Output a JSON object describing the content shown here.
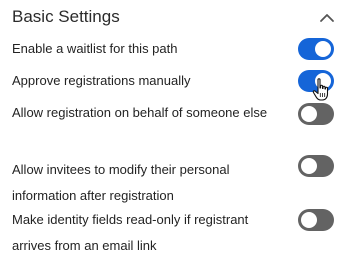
{
  "section": {
    "title": "Basic Settings",
    "collapse_icon": "chevron-up-icon"
  },
  "settings": [
    {
      "label": "Enable a waitlist for this path",
      "enabled": true
    },
    {
      "label": "Approve registrations manually",
      "enabled": true
    },
    {
      "label": "Allow registration on behalf of someone else",
      "enabled": false
    },
    {
      "label": "Allow invitees to modify their personal information after registration",
      "enabled": false
    },
    {
      "label": "Make identity fields read-only if registrant arrives from an email link",
      "enabled": false
    }
  ],
  "colors": {
    "toggle_on": "#1565d8",
    "toggle_off": "#636363",
    "knob": "#ffffff",
    "text": "#232323"
  },
  "pointer": "hand-pointer-cursor-icon"
}
